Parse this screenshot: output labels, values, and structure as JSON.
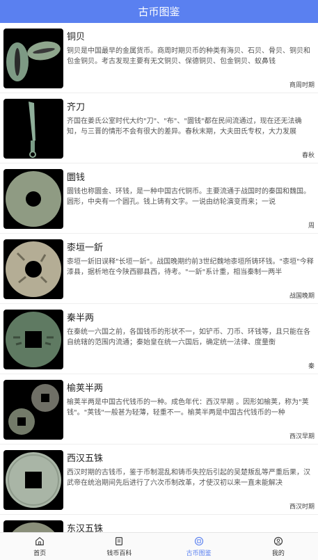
{
  "header": {
    "title": "古币图鉴"
  },
  "coins": [
    {
      "name": "铜贝",
      "desc": "铜贝是中国最早的金属货币。商周时期贝币的种类有海贝、石贝、骨贝、铜贝和包金铜贝。考古发现主要有无文铜贝、保德铜贝、包金铜贝、蚁鼻钱",
      "era": "商周时期"
    },
    {
      "name": "齐刀",
      "desc": "齐国在姜氏公室时代大约\"刀\"、\"布\"、\"圜钱\"都在民间流通过，现在还无法确知，与三晋的情形不会有很大的差异。春秋末期，大夫田氏专权，大力发展",
      "era": "春秋"
    },
    {
      "name": "圜钱",
      "desc": "圜钱也称圜金、环钱，是一种中国古代铜币。主要流通于战国时的秦国和魏国。圆形，中央有一个圆孔。钱上铸有文字。一说由纺轮演变而来；一说",
      "era": "周"
    },
    {
      "name": "桼垣一釿",
      "desc": "桼垣一釿旧误释\"长垣一釿\"。战国晚期约前3世纪魏地桼垣所铸环钱。\"桼垣\"今释漆县，据析地在今陕西郦县西，待考。\"一釿\"系计重，相当秦制一两半",
      "era": "战国晚期"
    },
    {
      "name": "秦半两",
      "desc": "在秦统一六国之前，各国钱币的形状不一，如铲币、刀币、环钱等，且只能在各自统辖的范围内流通；秦始皇在统一六国后，确定统一法律、度量衡",
      "era": "秦"
    },
    {
      "name": "榆荚半两",
      "desc": "榆荚半两是中国古代钱币的一种。成色年代：西汉早期 。因形如榆荚，称为\"荚钱\"。\"荚钱\"一般甚为轻薄，轻重不一。榆荚半两是中国古代钱币的一种",
      "era": "西汉早期"
    },
    {
      "name": "西汉五铢",
      "desc": "西汉时期的古钱币，鉴于币制混乱和铸币失控后引起的吴楚叛乱等严重后果，汉武帝在统治期间先后进行了六次币制改革，才使汉初以来一直未能解决",
      "era": "西汉时期"
    },
    {
      "name": "东汉五铢",
      "desc": "",
      "era": ""
    }
  ],
  "tabs": [
    {
      "label": "首页",
      "icon": "home-icon"
    },
    {
      "label": "钱币百科",
      "icon": "book-icon"
    },
    {
      "label": "古币图鉴",
      "icon": "coin-icon"
    },
    {
      "label": "我的",
      "icon": "user-icon"
    }
  ],
  "colors": {
    "accent": "#5a80f0",
    "inactive": "#333333"
  }
}
